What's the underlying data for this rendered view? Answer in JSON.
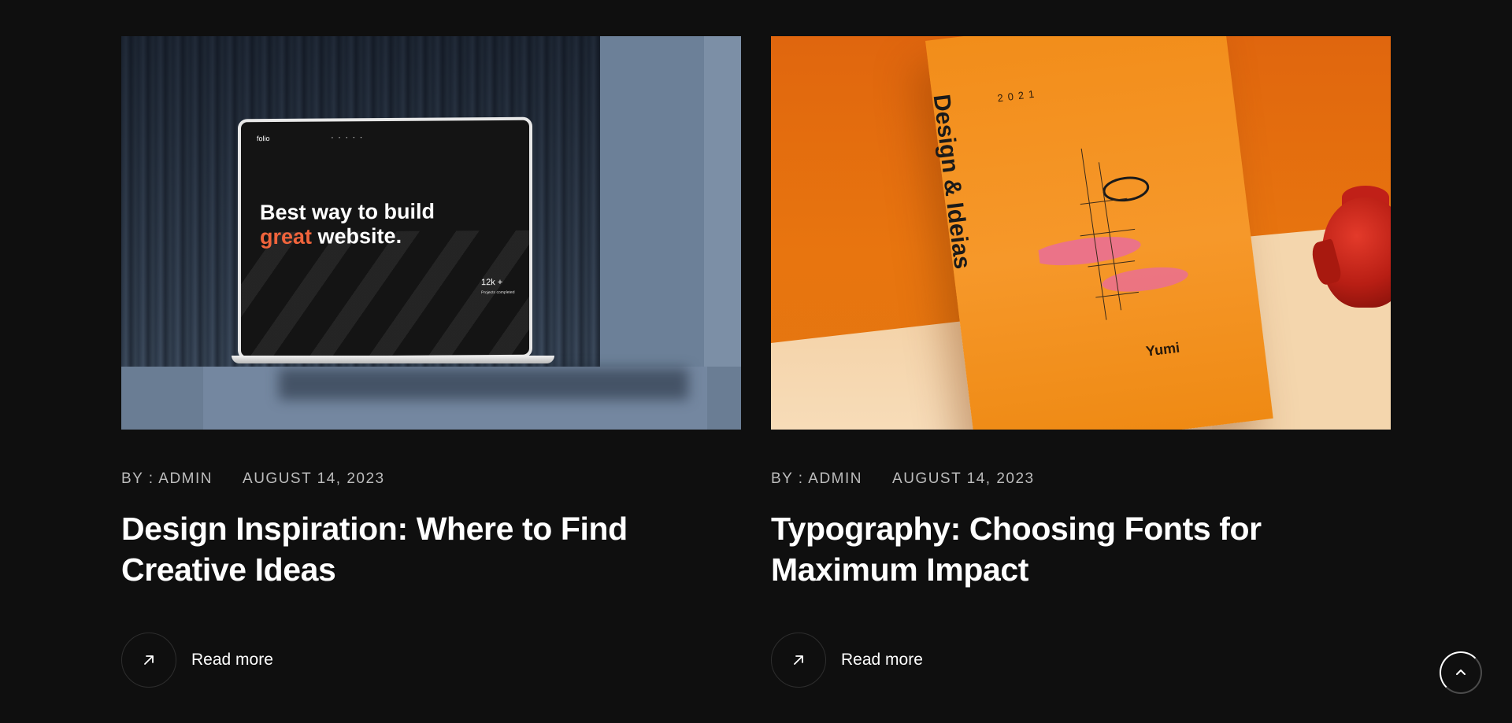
{
  "posts": [
    {
      "author": "BY : ADMIN",
      "date": "AUGUST 14, 2023",
      "title": "Design Inspiration: Where to Find Creative Ideas",
      "read_more": "Read more",
      "image": {
        "logo": "folio",
        "headline_line1": "Best way to build",
        "headline_accent": "great",
        "headline_rest": " website.",
        "stat": "12k +",
        "stat_sub": "Projects completed"
      }
    },
    {
      "author": "BY : ADMIN",
      "date": "AUGUST 14, 2023",
      "title": "Typography: Choosing Fonts for Maximum Impact",
      "read_more": "Read more",
      "image": {
        "poster_title": "Design & Ideias",
        "poster_year": "2021",
        "poster_brand": "Yumi"
      }
    }
  ],
  "icons": {
    "read_more": "arrow-up-right-icon",
    "scroll_top": "chevron-up-icon"
  },
  "colors": {
    "background": "#0f0f0f",
    "accent": "#f0643c"
  }
}
